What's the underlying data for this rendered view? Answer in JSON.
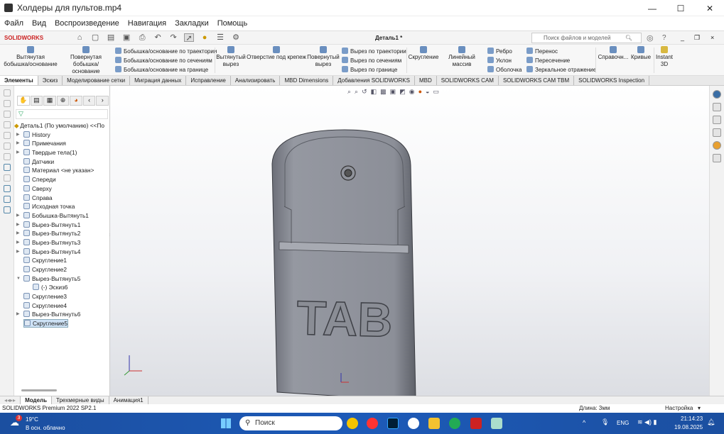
{
  "window": {
    "title": "Холдеры для пультов.mp4"
  },
  "menu": [
    "Файл",
    "Вид",
    "Воспроизведение",
    "Навигация",
    "Закладки",
    "Помощь"
  ],
  "sw": {
    "logo": "SOLIDWORKS",
    "doc_title": "Деталь1 *",
    "search_placeholder": "Поиск файлов и моделей"
  },
  "ribbon": {
    "extrude_boss": [
      "Вытянутая",
      "бобышка/основание"
    ],
    "revolve_boss": [
      "Повернутая",
      "бобышка/основание"
    ],
    "boss_small": [
      "Бобышка/основание по траектории",
      "Бобышка/основание по сечениям",
      "Бобышка/основание на границе"
    ],
    "extrude_cut": [
      "Вытянутый",
      "вырез"
    ],
    "hole": "Отверстие под крепеж",
    "revolve_cut": [
      "Повернутый",
      "вырез"
    ],
    "cut_small": [
      "Вырез по траектории",
      "Вырез по сечениям",
      "Вырез по границе"
    ],
    "fillet": "Скругление",
    "pattern": "Линейный массив",
    "col3": [
      "Ребро",
      "Уклон",
      "Оболочка"
    ],
    "col4": [
      "Перенос",
      "Пересечение",
      "Зеркальное отражение"
    ],
    "ref": "Справочн...",
    "curves": "Кривые",
    "instant": [
      "Instant",
      "3D"
    ]
  },
  "tabs": [
    {
      "label": "Элементы",
      "active": true
    },
    {
      "label": "Эскиз"
    },
    {
      "label": "Моделирование сетки"
    },
    {
      "label": "Миграция данных"
    },
    {
      "label": "Исправление"
    },
    {
      "label": "Анализировать"
    },
    {
      "label": "MBD Dimensions"
    },
    {
      "label": "Добавления SOLIDWORKS"
    },
    {
      "label": "MBD"
    },
    {
      "label": "SOLIDWORKS CAM"
    },
    {
      "label": "SOLIDWORKS CAM TBM"
    },
    {
      "label": "SOLIDWORKS Inspection"
    }
  ],
  "tree": {
    "root": "Деталь1 (По умолчанию) <<По",
    "items": [
      {
        "label": "History",
        "arrow": true
      },
      {
        "label": "Примечания",
        "arrow": true
      },
      {
        "label": "Твердые тела(1)",
        "arrow": true
      },
      {
        "label": "Датчики"
      },
      {
        "label": "Материал <не указан>"
      },
      {
        "label": "Спереди"
      },
      {
        "label": "Сверху"
      },
      {
        "label": "Справа"
      },
      {
        "label": "Исходная точка"
      },
      {
        "label": "Бобышка-Вытянуть1",
        "arrow": true
      },
      {
        "label": "Вырез-Вытянуть1",
        "arrow": true
      },
      {
        "label": "Вырез-Вытянуть2",
        "arrow": true
      },
      {
        "label": "Вырез-Вытянуть3",
        "arrow": true
      },
      {
        "label": "Вырез-Вытянуть4",
        "arrow": true
      },
      {
        "label": "Скругление1"
      },
      {
        "label": "Скругление2"
      },
      {
        "label": "Вырез-Вытянуть5",
        "arrow": true,
        "expanded": true
      },
      {
        "label": "(-) Эскиз6",
        "indent": true
      },
      {
        "label": "Скругление3"
      },
      {
        "label": "Скругление4"
      },
      {
        "label": "Вырез-Вытянуть6",
        "arrow": true
      },
      {
        "label": "Скругление5",
        "selected": true
      }
    ]
  },
  "model": {
    "text": "TAB",
    "color": "#8a8d96"
  },
  "bottom_tabs": [
    {
      "label": "Модель",
      "active": true
    },
    {
      "label": "Трехмерные виды"
    },
    {
      "label": "Анимация1"
    }
  ],
  "status": {
    "left": "SOLIDWORKS Premium 2022 SP2.1",
    "length": "Длина: 3мм",
    "settings": "Настройка"
  },
  "taskbar": {
    "temp": "19°C",
    "weather": "В осн. облачно",
    "badge": "3",
    "search": "Поиск",
    "lang": "ENG",
    "time": "21:14:23",
    "date": "19.08.2025"
  }
}
